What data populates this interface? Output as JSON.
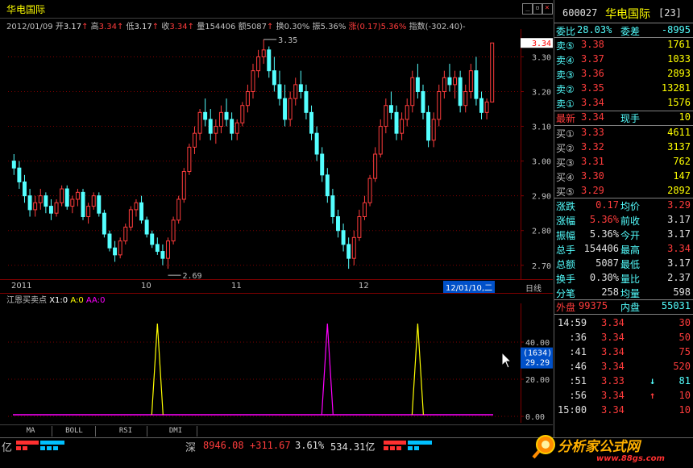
{
  "window": {
    "stock_name": "华电国际",
    "btn_min": "_",
    "btn_max": "▫",
    "btn_close": "×"
  },
  "info": {
    "date": "2012/01/09",
    "open_label": "开",
    "open": "3.17",
    "high_label": "高",
    "high": "3.34",
    "low_label": "低",
    "low": "3.17",
    "close_label": "收",
    "close": "3.34",
    "volume_label": "量",
    "volume": "154406",
    "amount_label": "额",
    "amount": "5087",
    "turnover_label": "换",
    "turnover": "0.30%",
    "amplitude_label": "振",
    "amplitude": "5.36%",
    "change_label": "涨",
    "change": "(0.17)5.36%",
    "index_label": "指数",
    "index": "(-302.40)-"
  },
  "chart_data": {
    "type": "candlestick",
    "price_axis": {
      "ticks": [
        "3.30",
        "3.20",
        "3.10",
        "3.00",
        "2.90",
        "2.80",
        "2.70"
      ],
      "ylim": [
        2.66,
        3.38
      ]
    },
    "current_price_tag": "3.34",
    "annotations": [
      {
        "label": "3.35",
        "value": 3.35
      },
      {
        "label": "2.69",
        "value": 2.69
      }
    ],
    "time_axis": {
      "labels": [
        "2011",
        "10",
        "11",
        "12"
      ],
      "cursor": "12/01/10,二",
      "period": "日线"
    },
    "candles": [
      [
        3.0,
        3.02,
        2.96,
        2.98
      ],
      [
        2.98,
        3.0,
        2.92,
        2.94
      ],
      [
        2.94,
        2.96,
        2.88,
        2.9
      ],
      [
        2.9,
        2.92,
        2.84,
        2.86
      ],
      [
        2.86,
        2.9,
        2.84,
        2.88
      ],
      [
        2.88,
        2.92,
        2.86,
        2.9
      ],
      [
        2.9,
        2.91,
        2.85,
        2.87
      ],
      [
        2.87,
        2.89,
        2.83,
        2.85
      ],
      [
        2.85,
        2.89,
        2.84,
        2.88
      ],
      [
        2.88,
        2.93,
        2.87,
        2.92
      ],
      [
        2.92,
        2.93,
        2.86,
        2.87
      ],
      [
        2.87,
        2.9,
        2.85,
        2.89
      ],
      [
        2.89,
        2.92,
        2.87,
        2.91
      ],
      [
        2.91,
        2.92,
        2.83,
        2.84
      ],
      [
        2.84,
        2.88,
        2.82,
        2.87
      ],
      [
        2.87,
        2.91,
        2.86,
        2.9
      ],
      [
        2.9,
        2.91,
        2.84,
        2.85
      ],
      [
        2.85,
        2.86,
        2.78,
        2.79
      ],
      [
        2.79,
        2.8,
        2.74,
        2.75
      ],
      [
        2.75,
        2.77,
        2.71,
        2.73
      ],
      [
        2.73,
        2.78,
        2.72,
        2.77
      ],
      [
        2.77,
        2.82,
        2.76,
        2.81
      ],
      [
        2.81,
        2.87,
        2.8,
        2.86
      ],
      [
        2.86,
        2.89,
        2.84,
        2.88
      ],
      [
        2.88,
        2.9,
        2.82,
        2.83
      ],
      [
        2.83,
        2.84,
        2.78,
        2.79
      ],
      [
        2.79,
        2.8,
        2.75,
        2.76
      ],
      [
        2.76,
        2.78,
        2.73,
        2.74
      ],
      [
        2.74,
        2.76,
        2.7,
        2.72
      ],
      [
        2.72,
        2.78,
        2.69,
        2.77
      ],
      [
        2.77,
        2.84,
        2.76,
        2.83
      ],
      [
        2.83,
        2.9,
        2.82,
        2.89
      ],
      [
        2.89,
        2.98,
        2.88,
        2.97
      ],
      [
        2.97,
        3.05,
        2.96,
        3.04
      ],
      [
        3.04,
        3.1,
        3.02,
        3.08
      ],
      [
        3.08,
        3.15,
        3.06,
        3.14
      ],
      [
        3.14,
        3.18,
        3.1,
        3.12
      ],
      [
        3.12,
        3.15,
        3.06,
        3.08
      ],
      [
        3.08,
        3.12,
        3.05,
        3.1
      ],
      [
        3.1,
        3.16,
        3.08,
        3.14
      ],
      [
        3.14,
        3.18,
        3.1,
        3.12
      ],
      [
        3.12,
        3.14,
        3.06,
        3.08
      ],
      [
        3.08,
        3.12,
        3.06,
        3.11
      ],
      [
        3.11,
        3.17,
        3.1,
        3.16
      ],
      [
        3.16,
        3.22,
        3.14,
        3.2
      ],
      [
        3.2,
        3.28,
        3.18,
        3.26
      ],
      [
        3.26,
        3.32,
        3.24,
        3.3
      ],
      [
        3.3,
        3.35,
        3.28,
        3.32
      ],
      [
        3.32,
        3.33,
        3.24,
        3.26
      ],
      [
        3.26,
        3.3,
        3.2,
        3.22
      ],
      [
        3.22,
        3.26,
        3.16,
        3.18
      ],
      [
        3.18,
        3.22,
        3.1,
        3.12
      ],
      [
        3.12,
        3.2,
        3.1,
        3.18
      ],
      [
        3.18,
        3.24,
        3.16,
        3.22
      ],
      [
        3.22,
        3.26,
        3.18,
        3.2
      ],
      [
        3.2,
        3.22,
        3.12,
        3.14
      ],
      [
        3.14,
        3.16,
        3.06,
        3.08
      ],
      [
        3.08,
        3.1,
        3.0,
        3.02
      ],
      [
        3.02,
        3.04,
        2.94,
        2.96
      ],
      [
        2.96,
        2.98,
        2.88,
        2.9
      ],
      [
        2.9,
        2.92,
        2.82,
        2.84
      ],
      [
        2.84,
        2.86,
        2.78,
        2.8
      ],
      [
        2.8,
        2.82,
        2.74,
        2.76
      ],
      [
        2.76,
        2.78,
        2.69,
        2.72
      ],
      [
        2.72,
        2.8,
        2.7,
        2.78
      ],
      [
        2.78,
        2.86,
        2.77,
        2.84
      ],
      [
        2.84,
        2.9,
        2.83,
        2.88
      ],
      [
        2.88,
        2.96,
        2.87,
        2.95
      ],
      [
        2.95,
        3.04,
        2.94,
        3.02
      ],
      [
        3.02,
        3.12,
        3.01,
        3.1
      ],
      [
        3.1,
        3.18,
        3.08,
        3.16
      ],
      [
        3.16,
        3.2,
        3.12,
        3.14
      ],
      [
        3.14,
        3.16,
        3.06,
        3.08
      ],
      [
        3.08,
        3.14,
        3.06,
        3.12
      ],
      [
        3.12,
        3.18,
        3.1,
        3.16
      ],
      [
        3.16,
        3.26,
        3.14,
        3.24
      ],
      [
        3.24,
        3.28,
        3.18,
        3.2
      ],
      [
        3.2,
        3.22,
        3.12,
        3.14
      ],
      [
        3.14,
        3.16,
        3.04,
        3.06
      ],
      [
        3.06,
        3.14,
        3.04,
        3.12
      ],
      [
        3.12,
        3.22,
        3.1,
        3.2
      ],
      [
        3.2,
        3.26,
        3.18,
        3.24
      ],
      [
        3.24,
        3.28,
        3.2,
        3.22
      ],
      [
        3.22,
        3.26,
        3.18,
        3.24
      ],
      [
        3.24,
        3.26,
        3.14,
        3.16
      ],
      [
        3.16,
        3.22,
        3.14,
        3.2
      ],
      [
        3.2,
        3.28,
        3.18,
        3.26
      ],
      [
        3.26,
        3.3,
        3.16,
        3.18
      ],
      [
        3.18,
        3.2,
        3.12,
        3.14
      ],
      [
        3.14,
        3.18,
        3.12,
        3.17
      ],
      [
        3.17,
        3.34,
        3.17,
        3.34
      ]
    ],
    "indicator": {
      "title": "江恩买卖点",
      "legend": [
        {
          "label": "X1:0",
          "color": "#ffffff"
        },
        {
          "label": "A:0",
          "color": "#ffff00"
        },
        {
          "label": "AA:0",
          "color": "#ff00ff"
        }
      ],
      "axis_ticks": [
        "40.00",
        "20.00",
        "0.00"
      ],
      "ylim": [
        0,
        60
      ],
      "current_tag": "(1634)",
      "current_value": "29.29",
      "peaks": [
        {
          "index": 27,
          "value": 50,
          "color": "#ffff00"
        },
        {
          "index": 59,
          "value": 50,
          "color": "#ff00ff"
        },
        {
          "index": 76,
          "value": 50,
          "color": "#ffff00"
        }
      ]
    }
  },
  "tabs": [
    "MA",
    "BOLL",
    "RSI",
    "DMI"
  ],
  "status": {
    "yi_left": "亿",
    "market": "深",
    "index_value": "8946.08",
    "index_change": "+311.67",
    "index_pct": "3.61%",
    "amount": "534.31亿",
    "watermark_site": "分析家公式网",
    "watermark_url": "www.88gs.com"
  },
  "quote": {
    "code": "600027",
    "name": "华电国际",
    "count": "[23]",
    "weibi_label": "委比",
    "weibi": "28.03%",
    "weicha_label": "委差",
    "weicha": "-8995",
    "asks": [
      {
        "label": "卖⑤",
        "price": "3.38",
        "vol": "1761"
      },
      {
        "label": "卖④",
        "price": "3.37",
        "vol": "1033"
      },
      {
        "label": "卖③",
        "price": "3.36",
        "vol": "2893"
      },
      {
        "label": "卖②",
        "price": "3.35",
        "vol": "13281"
      },
      {
        "label": "卖①",
        "price": "3.34",
        "vol": "1576"
      }
    ],
    "last_label": "最新",
    "last": "3.34",
    "xianshou_label": "现手",
    "xianshou": "10",
    "bids": [
      {
        "label": "买①",
        "price": "3.33",
        "vol": "4611"
      },
      {
        "label": "买②",
        "price": "3.32",
        "vol": "3137"
      },
      {
        "label": "买③",
        "price": "3.31",
        "vol": "762"
      },
      {
        "label": "买④",
        "price": "3.30",
        "vol": "147"
      },
      {
        "label": "买⑤",
        "price": "3.29",
        "vol": "2892"
      }
    ],
    "stats": [
      {
        "l1": "涨跌",
        "v1": "0.17",
        "l2": "均价",
        "v2": "3.29"
      },
      {
        "l1": "涨幅",
        "v1": "5.36%",
        "l2": "前收",
        "v2": "3.17"
      },
      {
        "l1": "振幅",
        "v1": "5.36%",
        "l2": "今开",
        "v2": "3.17"
      },
      {
        "l1": "总手",
        "v1": "154406",
        "l2": "最高",
        "v2": "3.34"
      },
      {
        "l1": "总额",
        "v1": "5087",
        "l2": "最低",
        "v2": "3.17"
      },
      {
        "l1": "换手",
        "v1": "0.30%",
        "l2": "量比",
        "v2": "2.37"
      },
      {
        "l1": "分笔",
        "v1": "258",
        "l2": "均量",
        "v2": "598"
      }
    ],
    "outer_label": "外盘",
    "outer": "99375",
    "inner_label": "内盘",
    "inner": "55031",
    "ticks": [
      {
        "time": "14:59",
        "price": "3.34",
        "vol": "30",
        "arrow": ""
      },
      {
        "time": ":36",
        "price": "3.34",
        "vol": "50",
        "arrow": ""
      },
      {
        "time": ":41",
        "price": "3.34",
        "vol": "75",
        "arrow": ""
      },
      {
        "time": ":46",
        "price": "3.34",
        "vol": "520",
        "arrow": ""
      },
      {
        "time": ":51",
        "price": "3.33",
        "vol": "81",
        "arrow": "↓"
      },
      {
        "time": ":56",
        "price": "3.34",
        "vol": "10",
        "arrow": "↑"
      },
      {
        "time": "15:00",
        "price": "3.34",
        "vol": "10",
        "arrow": ""
      }
    ]
  }
}
